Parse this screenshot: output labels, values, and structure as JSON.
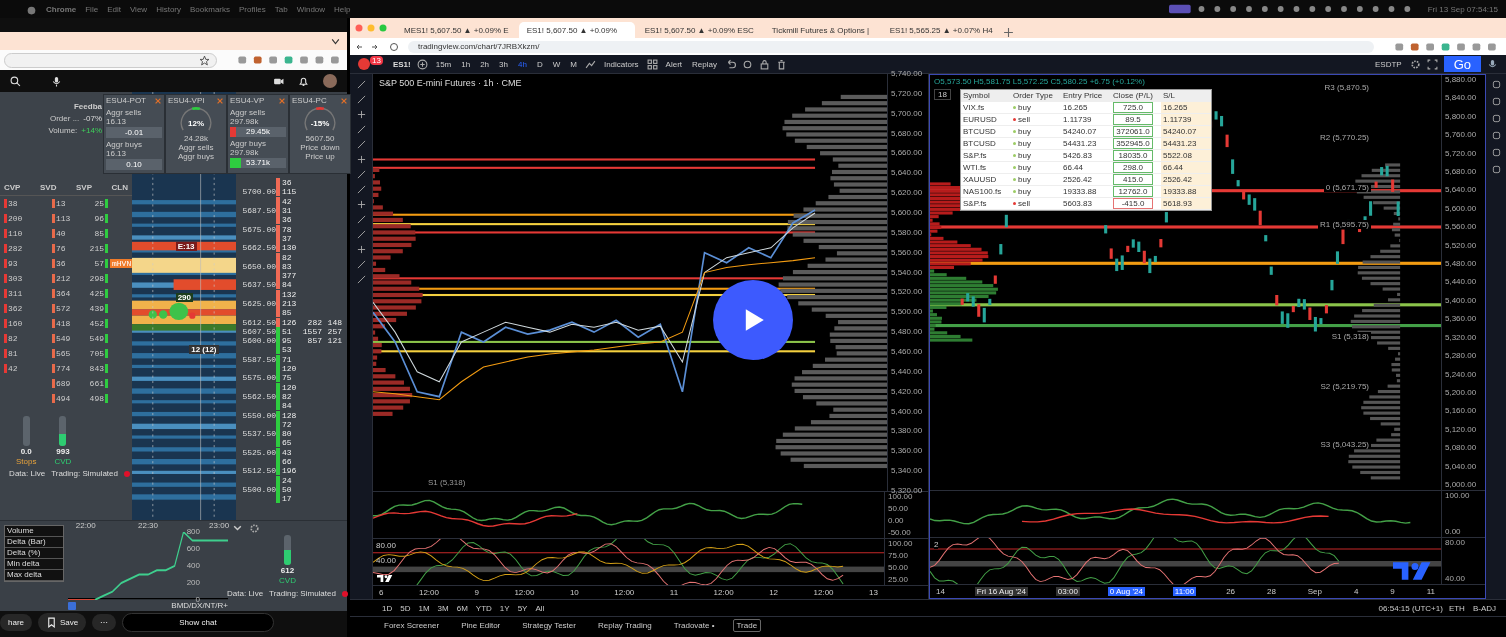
{
  "menu_bar": {
    "app": "Chrome",
    "items": [
      "File",
      "Edit",
      "View",
      "History",
      "Bookmarks",
      "Profiles",
      "Tab",
      "Window",
      "Help"
    ],
    "clock": "Fri 13 Sep 07:54:15"
  },
  "left_window": {
    "dom": {
      "title": "Feedba",
      "stats": [
        {
          "label": "Order ...",
          "value": "-07%",
          "kind": "neg"
        },
        {
          "label": "Volume:",
          "value": "+14%",
          "kind": "pos"
        }
      ],
      "widgets": [
        {
          "title": "ESU4-POT",
          "kind": "fields",
          "rows": [
            {
              "label": "Aggr sells",
              "stat": "16.13",
              "value": "-0.01"
            },
            {
              "label": "Aggr buys",
              "stat": "16.13",
              "value": "0.10"
            }
          ]
        },
        {
          "title": "ESU4-VPI",
          "kind": "gauge",
          "value": "12%",
          "sub": "24.28k",
          "left": "Aggr sells",
          "right": "Aggr buys",
          "color": "#2ecc40"
        },
        {
          "title": "ESU4-VP",
          "kind": "bars",
          "rows": [
            {
              "label": "Aggr sells 297.98k",
              "value": "29.45k",
              "color": "#e53935",
              "level": 0.1
            },
            {
              "label": "Aggr buys 297.98k",
              "value": "53.71k",
              "color": "#2ecc40",
              "level": 0.2
            }
          ]
        },
        {
          "title": "ESU4-PC",
          "kind": "gauge",
          "value": "-15%",
          "sub": "5607.50",
          "left": "Price down",
          "right": "Price up",
          "color": "#e53935"
        }
      ],
      "columns": [
        "CVP",
        "SVD",
        "SVP",
        "CLN"
      ],
      "rows": [
        [
          "38",
          "13",
          "25"
        ],
        [
          "200",
          "113",
          "96"
        ],
        [
          "110",
          "40",
          "85"
        ],
        [
          "282",
          "76",
          "215"
        ],
        [
          "93",
          "36",
          "57"
        ],
        [
          "303",
          "212",
          "298"
        ],
        [
          "311",
          "364",
          "425"
        ],
        [
          "362",
          "572",
          "439"
        ],
        [
          "160",
          "418",
          "452"
        ],
        [
          "82",
          "549",
          "549"
        ],
        [
          "81",
          "565",
          "705"
        ],
        [
          "42",
          "774",
          "843"
        ],
        [
          "",
          "689",
          "661"
        ],
        [
          "",
          "494",
          "498"
        ]
      ],
      "zone_tag": "mHVN",
      "heatmap_labels": [
        {
          "text": "E:13",
          "kind": "sell"
        },
        {
          "text": "290",
          "kind": "buy"
        },
        {
          "text": "12 (12)",
          "kind": "trade"
        }
      ],
      "ladder": [
        {
          "volume": "36"
        },
        {
          "price": "5700.00",
          "volume": "115"
        },
        {
          "volume": "42"
        },
        {
          "price": "5687.50",
          "volume": "31"
        },
        {
          "volume": "36"
        },
        {
          "price": "5675.00",
          "volume": "78"
        },
        {
          "volume": "37"
        },
        {
          "price": "5662.50",
          "volume": "130"
        },
        {
          "volume": "82"
        },
        {
          "price": "5650.00",
          "volume": "83"
        },
        {
          "volume": "377"
        },
        {
          "price": "5637.50",
          "volume": "84"
        },
        {
          "volume": "132"
        },
        {
          "price": "5625.00",
          "volume": "213"
        },
        {
          "volume": "85"
        },
        {
          "price": "5612.50",
          "volume": "126",
          "side": [
            "282",
            "148"
          ]
        },
        {
          "price": "5607.50",
          "volume": "51",
          "side": [
            "1557",
            "257"
          ]
        },
        {
          "price": "5600.00",
          "volume": "95",
          "side": [
            "857",
            "121"
          ]
        },
        {
          "volume": "53"
        },
        {
          "price": "5587.50",
          "volume": "71"
        },
        {
          "volume": "120"
        },
        {
          "price": "5575.00",
          "volume": "75"
        },
        {
          "volume": "120"
        },
        {
          "price": "5562.50",
          "volume": "82"
        },
        {
          "volume": "84"
        },
        {
          "price": "5550.00",
          "volume": "128"
        },
        {
          "volume": "72"
        },
        {
          "price": "5537.50",
          "volume": "80"
        },
        {
          "volume": "65"
        },
        {
          "price": "5525.00",
          "volume": "43"
        },
        {
          "volume": "66"
        },
        {
          "price": "5512.50",
          "volume": "196"
        },
        {
          "volume": "24"
        },
        {
          "price": "5500.00",
          "volume": "50"
        },
        {
          "volume": "17"
        }
      ],
      "meters": [
        {
          "value": "0.0",
          "label": "Stops"
        },
        {
          "value": "993",
          "label": "CVD",
          "level": 0.4
        }
      ],
      "status": [
        "Data: Live",
        "Trading: Simulated"
      ]
    },
    "mini_chart": {
      "menu": [
        "Volume",
        "Delta (Bar)",
        "Delta (%)",
        "Min delta",
        "Max delta"
      ],
      "chart_data": {
        "type": "line",
        "ylim": [
          0,
          800
        ],
        "categories": [
          null,
          null,
          "22:00",
          null,
          null,
          null,
          null,
          null,
          null,
          "22:30",
          null,
          null,
          null,
          null,
          null,
          null,
          null,
          "23:00",
          null
        ],
        "yticks": [
          800,
          600,
          400,
          200,
          0
        ],
        "series": [
          {
            "color": "#3ecf8e",
            "values": [
              null,
              null,
              null,
              0,
              50,
              100,
              200,
              250,
              300,
              300,
              350,
              350,
              400,
              800,
              700,
              700,
              700,
              700,
              700
            ]
          },
          {
            "color": "#e04a3a",
            "values": [
              0,
              0,
              0,
              0,
              null,
              null,
              null,
              null,
              null,
              null,
              null,
              null,
              null,
              null,
              null,
              null,
              null,
              null,
              null
            ]
          }
        ]
      },
      "feed": "BMD/DX/NT/R+",
      "meter": {
        "value": "612",
        "label": "CVD",
        "level": 0.5
      },
      "status": [
        "Data: Live",
        "Trading: Simulated"
      ]
    },
    "actions": [
      "hare",
      "Save"
    ],
    "more": "⋯",
    "show_chat": "Show chat"
  },
  "right_window": {
    "tabs": [
      {
        "title": "MES1! 5,607.50 ▲ +0.09% E",
        "selected": false
      },
      {
        "title": "ES1! 5,607.50 ▲ +0.09%",
        "selected": true
      },
      {
        "title": "ES1! 5,607.50 ▲ +0.09% ESC",
        "selected": false
      },
      {
        "title": "Tickmill Futures & Options |",
        "selected": false
      },
      {
        "title": "ES1! 5,565.25 ▲ +0.07% H4",
        "selected": false
      }
    ],
    "url": "tradingview.com/chart/7JRBXkzm/",
    "toolbar": {
      "badge": "13",
      "symbol": "ES1!",
      "intervals": [
        {
          "label": "15m",
          "selected": false
        },
        {
          "label": "1h",
          "selected": false
        },
        {
          "label": "2h",
          "selected": false
        },
        {
          "label": "3h",
          "selected": false
        },
        {
          "label": "4h",
          "selected": true
        },
        {
          "label": "D",
          "selected": false
        },
        {
          "label": "W",
          "selected": false
        },
        {
          "label": "M",
          "selected": false
        }
      ],
      "indicators": "Indicators",
      "alert": "Alert",
      "replay": "Replay",
      "layout": "ESDTP",
      "go": "Go"
    },
    "left_chart": {
      "title": "S&P 500 E-mini Futures · 1h · CME",
      "chart_data": {
        "type": "line",
        "ylim": [
          5320,
          5740
        ],
        "yticks": [
          {
            "value": 5740,
            "label": "5,740.00"
          },
          {
            "value": 5720,
            "label": "5,720.00"
          },
          {
            "value": 5700,
            "label": "5,700.00"
          },
          {
            "value": 5680,
            "label": "5,680.00"
          },
          {
            "value": 5660,
            "label": "5,660.00"
          },
          {
            "value": 5640,
            "label": "5,640.00"
          },
          {
            "value": 5620,
            "label": "5,620.00"
          },
          {
            "value": 5600,
            "label": "5,600.00"
          },
          {
            "value": 5580,
            "label": "5,580.00"
          },
          {
            "value": 5560,
            "label": "5,560.00"
          },
          {
            "value": 5540,
            "label": "5,540.00"
          },
          {
            "value": 5520,
            "label": "5,520.00"
          },
          {
            "value": 5500,
            "label": "5,500.00"
          },
          {
            "value": 5480,
            "label": "5,480.00"
          },
          {
            "value": 5460,
            "label": "5,460.00"
          },
          {
            "value": 5440,
            "label": "5,440.00"
          },
          {
            "value": 5420,
            "label": "5,420.00"
          },
          {
            "value": 5400,
            "label": "5,400.00"
          },
          {
            "value": 5380,
            "label": "5,380.00"
          },
          {
            "value": 5360,
            "label": "5,360.00"
          },
          {
            "value": 5340,
            "label": "5,340.00"
          },
          {
            "value": 5320,
            "label": "5,320.00"
          }
        ],
        "series": [
          {
            "color": "#5b8fd6",
            "values": [
              5500,
              5470,
              5420,
              5415,
              5480,
              5470,
              5485,
              5478,
              5482,
              5490,
              5480,
              5492,
              5475,
              5488,
              5420,
              5560,
              5550,
              5565,
              5555,
              5590,
              5603
            ]
          },
          {
            "color": "#cfd8dc",
            "values": [
              5510,
              5480,
              5440,
              5430,
              5470,
              5480,
              5490,
              5485,
              5480,
              5488,
              5485,
              5490,
              5482,
              5486,
              5450,
              5540,
              5555,
              5560,
              5565,
              5585,
              5600
            ]
          },
          {
            "color": "#f39c12",
            "values": [
              5420,
              5418,
              5415,
              5412,
              5430,
              5445,
              5450,
              5455,
              5458,
              5460,
              5462,
              5465,
              5468,
              5470,
              5480,
              5540,
              5545,
              5548,
              5550,
              5552,
              5555
            ]
          }
        ]
      },
      "pivot": "S1 (5,318)",
      "times": [
        "6",
        "12:00",
        "9",
        "12:00",
        "10",
        "12:00",
        "11",
        "12:00",
        "12",
        "12:00",
        "13"
      ],
      "osc_axis": [
        "100.00",
        "50.00",
        "0.00",
        "-50.00"
      ],
      "stoch_axis": [
        "100.00",
        "75.00",
        "50.00",
        "25.00"
      ],
      "stoch_levels": [
        "80.00",
        "40.00"
      ]
    },
    "right_chart": {
      "ohlc": "O5,573.50 H5,581.75 L5,572.25 C5,580.25 +6.75 (+0.12%)",
      "legend_count": "18",
      "table": {
        "columns": [
          "Symbol",
          "Order Type",
          "Entry Price",
          "Close (P/L)",
          "S/L"
        ],
        "rows": [
          {
            "symbol": "VIX.fs",
            "side": "buy",
            "entry": "16.265",
            "close": "725.0",
            "sl": "16.265",
            "profit": true
          },
          {
            "symbol": "EURUSD",
            "side": "sell",
            "entry": "1.11739",
            "close": "89.5",
            "sl": "1.11739",
            "profit": true
          },
          {
            "symbol": "BTCUSD",
            "side": "buy",
            "entry": "54240.07",
            "close": "372061.0",
            "sl": "54240.07",
            "profit": true
          },
          {
            "symbol": "BTCUSD",
            "side": "buy",
            "entry": "54431.23",
            "close": "352945.0",
            "sl": "54431.23",
            "profit": true
          },
          {
            "symbol": "S&P.fs",
            "side": "buy",
            "entry": "5426.83",
            "close": "18035.0",
            "sl": "5522.08",
            "profit": true
          },
          {
            "symbol": "WTI.fs",
            "side": "buy",
            "entry": "66.44",
            "close": "298.0",
            "sl": "66.44",
            "profit": true
          },
          {
            "symbol": "XAUUSD",
            "side": "buy",
            "entry": "2526.42",
            "close": "415.0",
            "sl": "2526.42",
            "profit": true
          },
          {
            "symbol": "NAS100.fs",
            "side": "buy",
            "entry": "19333.88",
            "close": "12762.0",
            "sl": "19333.88",
            "profit": true
          },
          {
            "symbol": "S&P.fs",
            "side": "sell",
            "entry": "5603.83",
            "close": "-415.0",
            "sl": "5618.93",
            "profit": false
          }
        ]
      },
      "price_axis": [
        "5,880.00",
        "5,840.00",
        "5,800.00",
        "5,760.00",
        "5,720.00",
        "5,680.00",
        "5,640.00",
        "5,600.00",
        "5,560.00",
        "5,520.00",
        "5,480.00",
        "5,440.00",
        "5,400.00",
        "5,360.00",
        "5,320.00",
        "5,280.00",
        "5,240.00",
        "5,200.00",
        "5,160.00",
        "5,120.00",
        "5,080.00",
        "5,040.00",
        "5,000.00"
      ],
      "levels": [
        "R3 (5,870.5)",
        "R2 (5,770.25)",
        "0 (5,671.75)",
        "R1 (5,595.75)",
        "S1 (5,318)",
        "S2 (5,219.75)",
        "S3 (5,043.25)"
      ],
      "osc_axis": [
        "100.00",
        "0.00"
      ],
      "stoch_axis": [
        "80.00",
        "40.00"
      ],
      "stoch_count": "2",
      "times": [
        {
          "text": "14",
          "kind": "plain"
        },
        {
          "text": "Fri 16 Aug '24",
          "kind": "cursor"
        },
        {
          "text": "03:00",
          "kind": "cursor"
        },
        {
          "text": "0 Aug '24",
          "kind": "range"
        },
        {
          "text": "11:00",
          "kind": "range"
        },
        {
          "text": "26",
          "kind": "plain"
        },
        {
          "text": "28",
          "kind": "plain"
        },
        {
          "text": "Sep",
          "kind": "plain"
        },
        {
          "text": "4",
          "kind": "plain"
        },
        {
          "text": "9",
          "kind": "plain"
        },
        {
          "text": "11",
          "kind": "plain"
        }
      ]
    },
    "ranges": [
      "1D",
      "5D",
      "1M",
      "3M",
      "6M",
      "YTD",
      "1Y",
      "5Y",
      "All"
    ],
    "clock": "06:54:15 (UTC+1)",
    "session": "ETH",
    "adjust": "B-ADJ",
    "bottom_tabs": [
      {
        "label": "Forex Screener",
        "selected": false
      },
      {
        "label": "Pine Editor",
        "selected": false
      },
      {
        "label": "Strategy Tester",
        "selected": false
      },
      {
        "label": "Replay Trading",
        "selected": false
      },
      {
        "label": "Tradovate •",
        "selected": false
      },
      {
        "label": "Trade",
        "selected": true
      }
    ]
  }
}
